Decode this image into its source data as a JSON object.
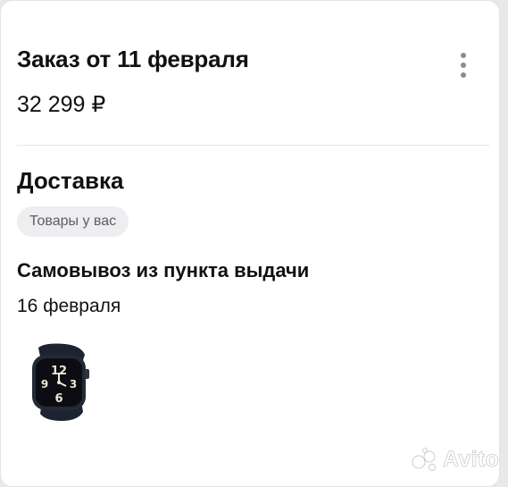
{
  "order": {
    "title": "Заказ от 11 февраля",
    "price": "32 299 ₽",
    "menu_icon": "more-vertical-icon"
  },
  "delivery": {
    "heading": "Доставка",
    "status_badge": "Товары у вас",
    "method": "Самовывоз из пункта выдачи",
    "date": "16 февраля"
  },
  "product": {
    "thumbnail": "smartwatch-image",
    "watch_dial_digits": [
      "12",
      "6",
      "9",
      "3"
    ]
  },
  "watermark": {
    "text": "Avito"
  },
  "colors": {
    "text": "#111111",
    "muted": "#5d5d62",
    "badge_bg": "#eeeef1",
    "divider": "#e6e6e9",
    "page_bg": "#e9e9ec"
  }
}
